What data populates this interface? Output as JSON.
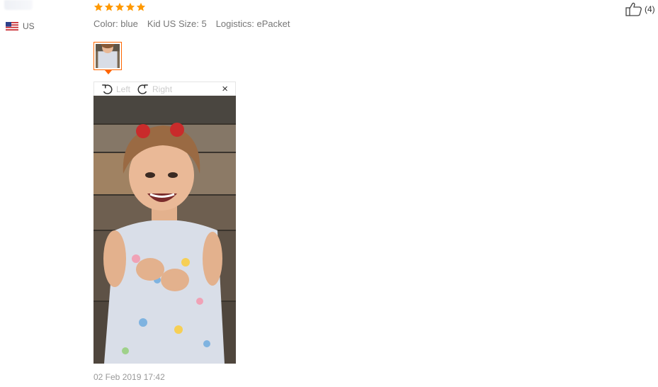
{
  "reviewer": {
    "country_code": "US",
    "flag_icon": "us-flag-icon"
  },
  "review": {
    "rating": 5,
    "attributes": {
      "color": "Color: blue",
      "size": "Kid US Size: 5",
      "logistics": "Logistics: ePacket"
    },
    "date": "02 Feb 2019 17:42"
  },
  "image_viewer": {
    "rotate_left_label": "Left",
    "rotate_right_label": "Right",
    "close_label": "×"
  },
  "helpful": {
    "count": "(4)",
    "icon": "thumbs-up-icon"
  },
  "colors": {
    "accent": "#ff6600",
    "star": "#ff9900",
    "muted": "#999999"
  }
}
